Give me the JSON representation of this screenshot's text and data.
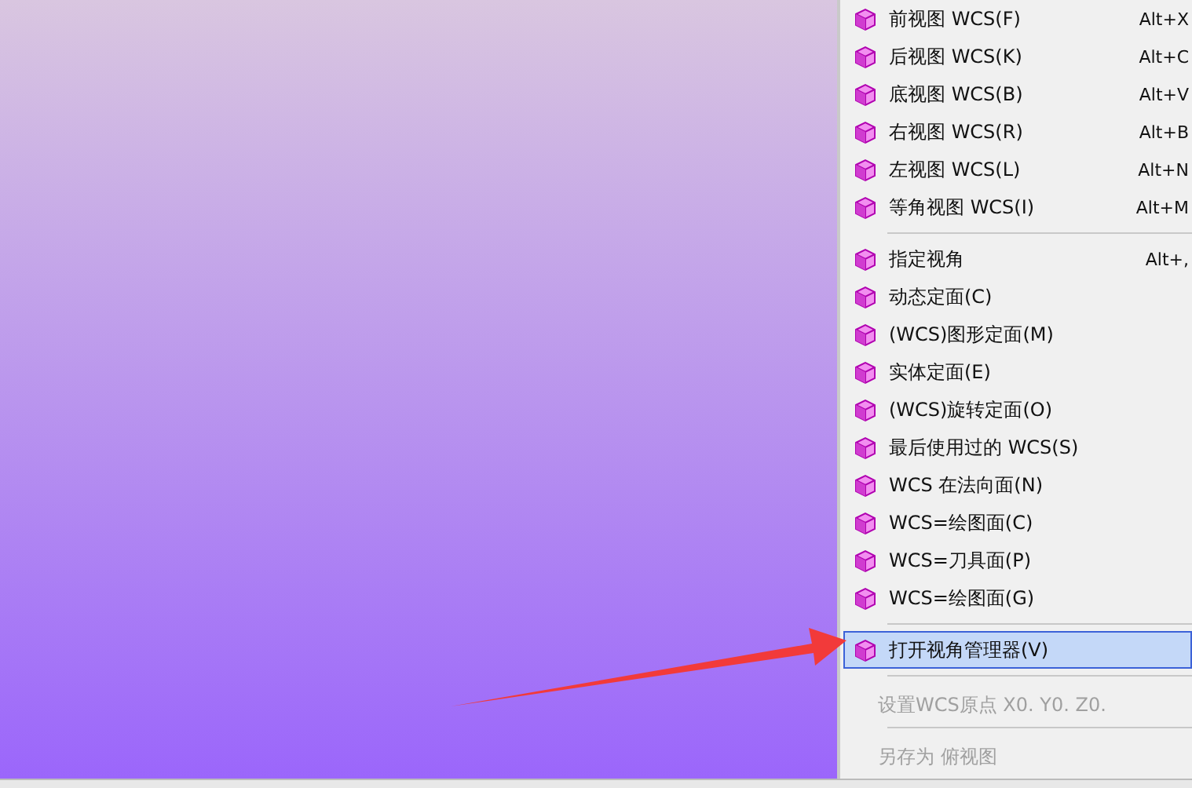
{
  "menu": {
    "items": [
      {
        "kind": "item",
        "label": "前视图 WCS(F)",
        "shortcut": "Alt+X",
        "selected": false,
        "disabled": false
      },
      {
        "kind": "item",
        "label": "后视图 WCS(K)",
        "shortcut": "Alt+C",
        "selected": false,
        "disabled": false
      },
      {
        "kind": "item",
        "label": "底视图 WCS(B)",
        "shortcut": "Alt+V",
        "selected": false,
        "disabled": false
      },
      {
        "kind": "item",
        "label": "右视图 WCS(R)",
        "shortcut": "Alt+B",
        "selected": false,
        "disabled": false
      },
      {
        "kind": "item",
        "label": "左视图 WCS(L)",
        "shortcut": "Alt+N",
        "selected": false,
        "disabled": false
      },
      {
        "kind": "item",
        "label": "等角视图 WCS(I)",
        "shortcut": "Alt+M",
        "selected": false,
        "disabled": false
      },
      {
        "kind": "separator"
      },
      {
        "kind": "item",
        "label": "指定视角",
        "shortcut": "Alt+,",
        "selected": false,
        "disabled": false
      },
      {
        "kind": "item",
        "label": "动态定面(C)",
        "selected": false,
        "disabled": false
      },
      {
        "kind": "item",
        "label": "(WCS)图形定面(M)",
        "selected": false,
        "disabled": false
      },
      {
        "kind": "item",
        "label": "实体定面(E)",
        "selected": false,
        "disabled": false
      },
      {
        "kind": "item",
        "label": "(WCS)旋转定面(O)",
        "selected": false,
        "disabled": false
      },
      {
        "kind": "item",
        "label": "最后使用过的 WCS(S)",
        "selected": false,
        "disabled": false
      },
      {
        "kind": "item",
        "label": "WCS 在法向面(N)",
        "selected": false,
        "disabled": false
      },
      {
        "kind": "item",
        "label": "WCS=绘图面(C)",
        "selected": false,
        "disabled": false
      },
      {
        "kind": "item",
        "label": "WCS=刀具面(P)",
        "selected": false,
        "disabled": false
      },
      {
        "kind": "item",
        "label": "WCS=绘图面(G)",
        "selected": false,
        "disabled": false
      },
      {
        "kind": "separator"
      },
      {
        "kind": "item",
        "label": "打开视角管理器(V)",
        "selected": true,
        "disabled": false
      },
      {
        "kind": "separator"
      },
      {
        "kind": "plain",
        "label": "设置WCS原点 X0. Y0. Z0.",
        "selected": false,
        "disabled": true
      },
      {
        "kind": "separator"
      },
      {
        "kind": "plain",
        "label": "另存为 俯视图",
        "selected": false,
        "disabled": true
      }
    ]
  }
}
